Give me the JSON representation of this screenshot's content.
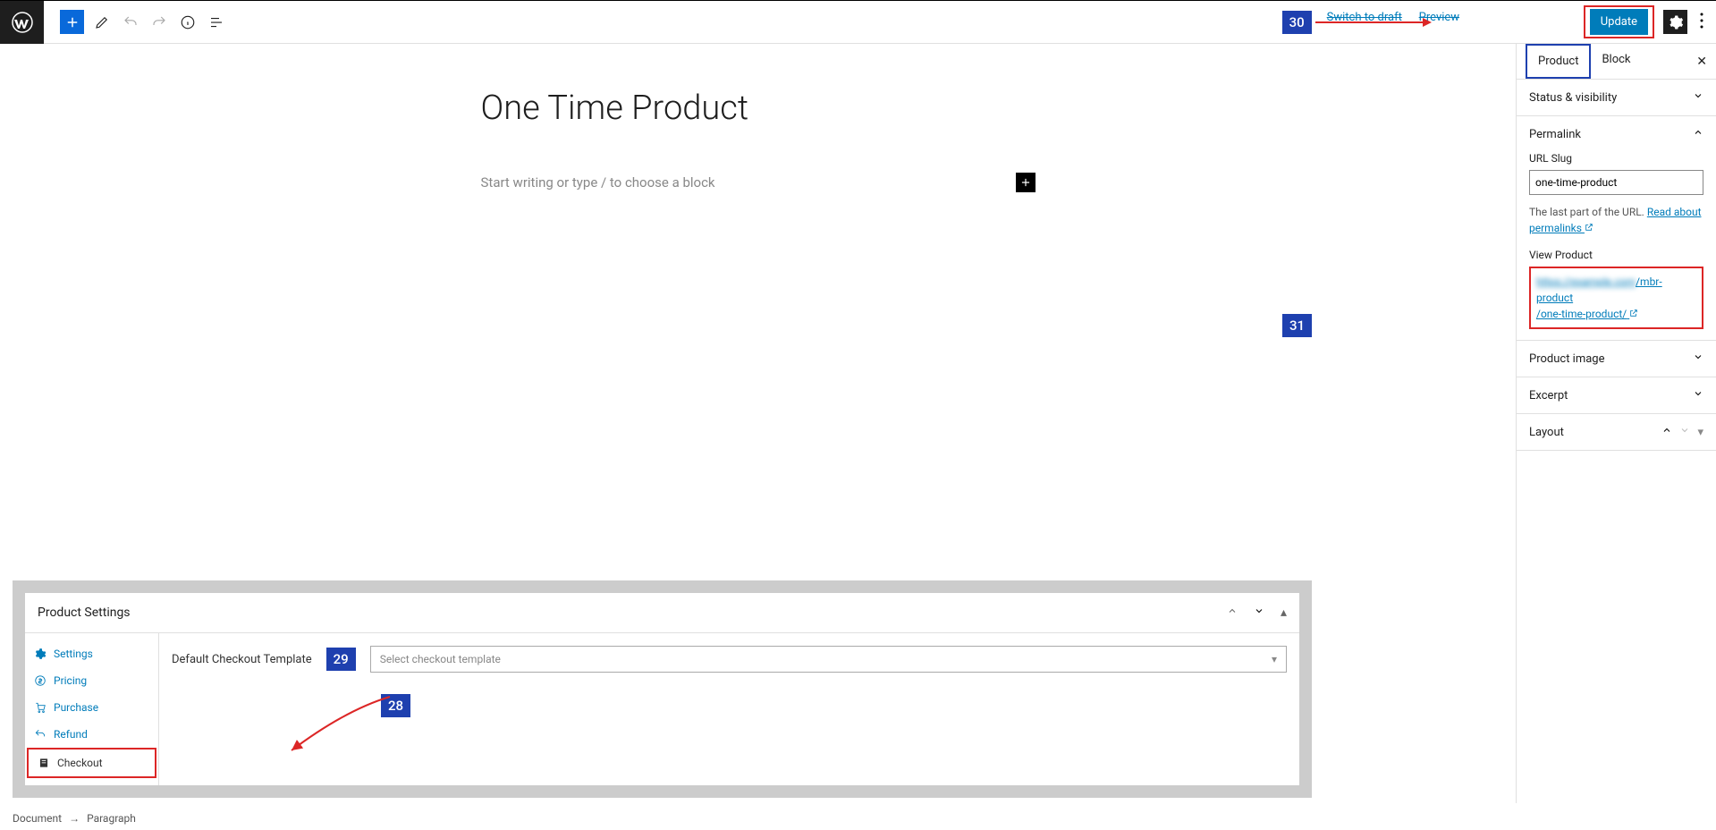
{
  "toolbar": {
    "switch_to_draft": "Switch to draft",
    "preview": "Preview",
    "update": "Update"
  },
  "editor": {
    "title": "One Time Product",
    "prompt": "Start writing or type / to choose a block"
  },
  "sidebar": {
    "tabs": {
      "product": "Product",
      "block": "Block"
    },
    "panels": {
      "status": "Status & visibility",
      "permalink": "Permalink",
      "product_image": "Product image",
      "excerpt": "Excerpt",
      "layout": "Layout"
    },
    "permalink": {
      "url_slug_label": "URL Slug",
      "url_slug_value": "one-time-product",
      "help_text": "The last part of the URL. ",
      "help_link": "Read about permalinks",
      "view_product_label": "View Product",
      "url_path": "/mbr-product",
      "url_tail": "/one-time-product/"
    }
  },
  "product_settings": {
    "title": "Product Settings",
    "nav": {
      "settings": "Settings",
      "pricing": "Pricing",
      "purchase": "Purchase",
      "refund": "Refund",
      "checkout": "Checkout"
    },
    "checkout": {
      "label": "Default Checkout Template",
      "placeholder": "Select checkout template"
    }
  },
  "breadcrumb": {
    "document": "Document",
    "paragraph": "Paragraph"
  },
  "annotations": {
    "a28": "28",
    "a29": "29",
    "a30": "30",
    "a31": "31"
  }
}
